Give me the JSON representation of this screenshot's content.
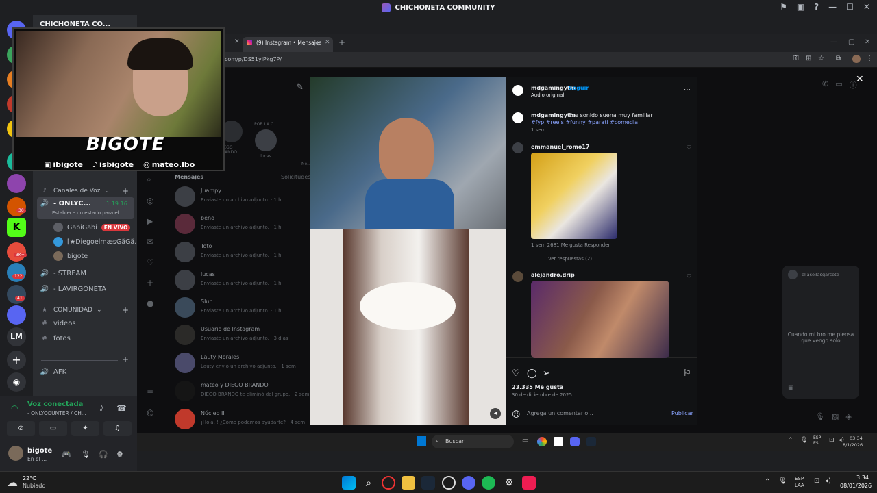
{
  "window": {
    "title": "CHICHONETA COMMUNITY",
    "controls": [
      "—",
      "☐",
      "✕"
    ]
  },
  "discord": {
    "server_name": "CHICHONETA CO...",
    "server_badges": [
      "30",
      "3K+",
      "122",
      "41"
    ],
    "server_lm": "LM",
    "voice_category": "Canales de Voz",
    "voice_channels": [
      {
        "name": "- ONLYC...",
        "timer": "1:19:16",
        "status": "Establece un estado para el..."
      },
      {
        "name": "- STREAM"
      },
      {
        "name": "- LAVIRGONETA"
      }
    ],
    "voice_users": [
      {
        "name": "GabiGabi",
        "badge": "EN VIVO"
      },
      {
        "name": "[★DiegoelmæsGãGã..."
      },
      {
        "name": "bigote"
      }
    ],
    "community_category": "COMUNIDAD",
    "text_channels": [
      "videos",
      "fotos"
    ],
    "afk_channel": "AFK",
    "connection": {
      "title": "Voz conectada",
      "detail": "- ONLYCOUNTER / CH..."
    },
    "user": {
      "name": "bigote",
      "status": "En el ..."
    }
  },
  "webcam": {
    "name": "BIGOTE",
    "socials": [
      {
        "icon": "twitch-icon",
        "handle": "ibigote"
      },
      {
        "icon": "tiktok-icon",
        "handle": "isbigote"
      },
      {
        "icon": "instagram-icon",
        "handle": "mateo.lbo"
      }
    ]
  },
  "browser": {
    "tab_title": "(9) Instagram • Mensajes",
    "url": "com/p/DS51ylPkg7P/"
  },
  "instagram": {
    "messages_label": "Mensajes",
    "requests_label": "Solicitudes",
    "story_labels": [
      "...",
      "POR LA C...",
      "DIEGO BRANDO",
      "lucas",
      "Ne..."
    ],
    "threads": [
      {
        "name": "Juampy",
        "msg": "Enviaste un archivo adjunto. · 1 h"
      },
      {
        "name": "beno",
        "msg": "Enviaste un archivo adjunto. · 1 h"
      },
      {
        "name": "Toto",
        "msg": "Enviaste un archivo adjunto. · 1 h"
      },
      {
        "name": "lucas",
        "msg": "Enviaste un archivo adjunto. · 1 h"
      },
      {
        "name": "Slun",
        "msg": "Enviaste un archivo adjunto. · 1 h"
      },
      {
        "name": "Usuario de Instagram",
        "msg": "Enviaste un archivo adjunto. · 3 días"
      },
      {
        "name": "Lauty Morales",
        "msg": "Lauty envió un archivo adjunto. · 1 sem"
      },
      {
        "name": "mateo y DIEGO BRANDO",
        "msg": "DIEGO BRANDO te eliminó del grupo. · 2 sem"
      },
      {
        "name": "Núcleo II",
        "msg": "¡Hola, ! ¿Cómo podemos ayudarte? · 4 sem"
      }
    ],
    "post": {
      "author": "mdgamingytm",
      "follow": "Seguir",
      "audio": "Audio original",
      "caption": "Ese sonido suena muy familiar",
      "hashtags": "#fyp #reels #funny #parati #comedia",
      "caption_age": "1 sem",
      "comments": [
        {
          "user": "emmanuel_romo17",
          "meta": "1 sem   2681 Me gusta   Responder",
          "replies": "Ver respuestas (2)"
        },
        {
          "user": "alejandro.drip"
        }
      ],
      "likes": "23.335 Me gusta",
      "date": "30 de diciembre de 2025",
      "comment_placeholder": "Agrega un comentario...",
      "publish": "Publicar"
    },
    "side_user": "ellaseilasgarcete",
    "side_caption": "Cuando mi bro me piensa que vengo solo"
  },
  "inner_taskbar": {
    "search": "Buscar",
    "lang": "ESP ES",
    "time": "03:34",
    "date": "8/1/2026"
  },
  "taskbar": {
    "weather_temp": "22°C",
    "weather_desc": "Nubiado",
    "lang": "ESP LAA",
    "time": "3:34",
    "date": "08/01/2026"
  }
}
